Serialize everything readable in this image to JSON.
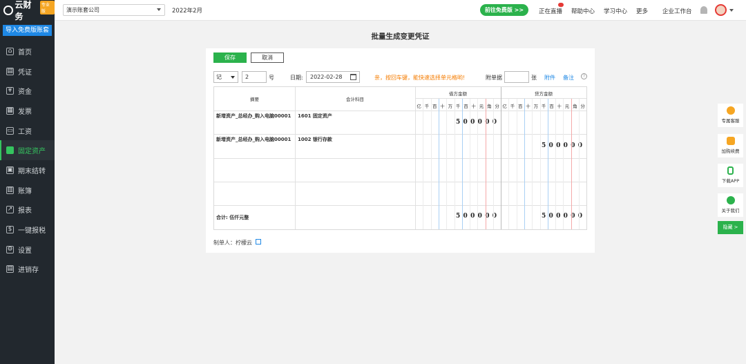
{
  "sidebar": {
    "logo": "云财务",
    "logo_badge": "专业版",
    "import_button": "导入免费版账套",
    "items": [
      {
        "label": "首页",
        "icon": "home-icon"
      },
      {
        "label": "凭证",
        "icon": "voucher-icon"
      },
      {
        "label": "资金",
        "icon": "fund-icon"
      },
      {
        "label": "发票",
        "icon": "invoice-icon"
      },
      {
        "label": "工资",
        "icon": "salary-icon"
      },
      {
        "label": "固定资产",
        "icon": "asset-icon",
        "active": true
      },
      {
        "label": "期末结转",
        "icon": "calendar-icon"
      },
      {
        "label": "账簿",
        "icon": "book-icon"
      },
      {
        "label": "报表",
        "icon": "chart-icon"
      },
      {
        "label": "一键报税",
        "icon": "tax-icon"
      },
      {
        "label": "设置",
        "icon": "gear-icon"
      },
      {
        "label": "进销存",
        "icon": "inventory-icon"
      }
    ]
  },
  "header": {
    "company": "演示账套公司",
    "period": "2022年2月",
    "free_button": "前往免费版 >>",
    "links": [
      "正在直播",
      "帮助中心",
      "学习中心",
      "更多",
      "企业工作台"
    ]
  },
  "page": {
    "title": "批量生成变更凭证",
    "save": "保存",
    "cancel": "取消",
    "voucher_word": "记",
    "voucher_no": "2",
    "hao": "号",
    "date_label": "日期:",
    "date": "2022-02-28",
    "tip": "亲，按回车键，能快速选择单元格哟!",
    "attach_label": "附单据",
    "zhang": "张",
    "attach_link": "附件",
    "note_link": "备注",
    "help": "?"
  },
  "grid": {
    "col_summary": "摘要",
    "col_account": "会计科目",
    "col_debit": "借方金额",
    "col_credit": "贷方金额",
    "digits": [
      "亿",
      "千",
      "百",
      "十",
      "万",
      "千",
      "百",
      "十",
      "元",
      "角",
      "分"
    ],
    "rows": [
      {
        "summary": "新增资产_总经办_购入电脑00001",
        "account": "1601 固定资产",
        "debit": "500000",
        "credit": ""
      },
      {
        "summary": "新增资产_总经办_购入电脑00001",
        "account": "1002 银行存款",
        "debit": "",
        "credit": "500000"
      }
    ],
    "total_label": "合计: 伍仟元整",
    "total_debit": "500000",
    "total_credit": "500000"
  },
  "maker": "制单人：柠檬云",
  "float_bar": {
    "items": [
      "专属客服",
      "加购续费",
      "下载APP",
      "关于我们"
    ],
    "hide": "隐藏 >"
  }
}
